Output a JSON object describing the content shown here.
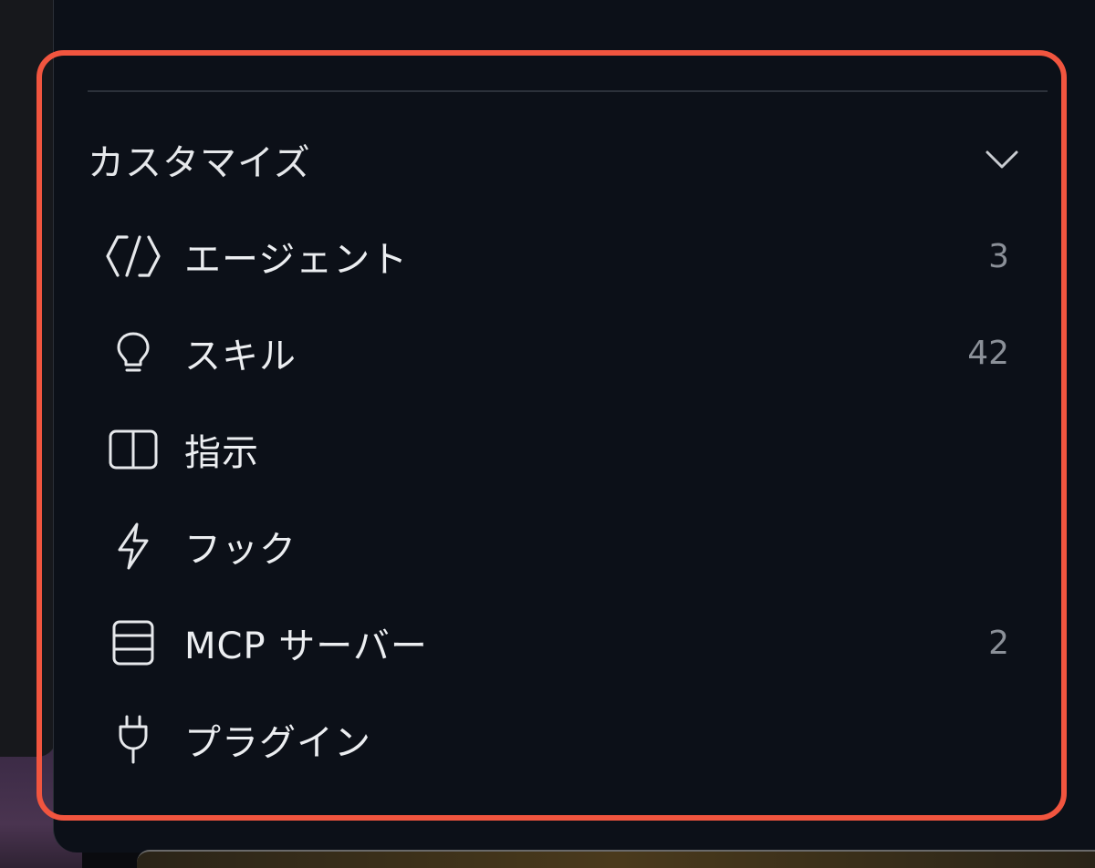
{
  "section": {
    "title": "カスタマイズ",
    "expanded": true
  },
  "items": [
    {
      "label": "エージェント",
      "count": "3",
      "icon": "code-agent-icon"
    },
    {
      "label": "スキル",
      "count": "42",
      "icon": "lightbulb-icon"
    },
    {
      "label": "指示",
      "count": "",
      "icon": "book-icon"
    },
    {
      "label": "フック",
      "count": "",
      "icon": "lightning-icon"
    },
    {
      "label": "MCP サーバー",
      "count": "2",
      "icon": "server-icon"
    },
    {
      "label": "プラグイン",
      "count": "",
      "icon": "plug-icon"
    }
  ],
  "colors": {
    "highlight": "#f1553f",
    "panel": "#0c1018",
    "text": "#eceef1",
    "count": "#8b9098"
  }
}
